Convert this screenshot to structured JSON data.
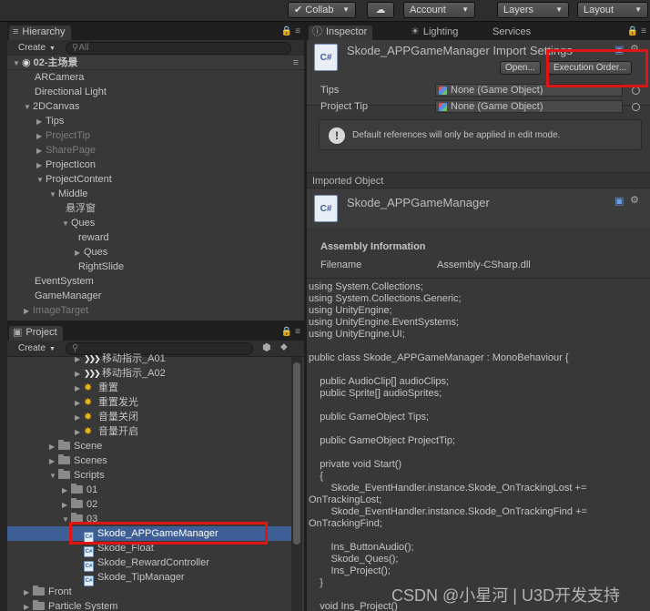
{
  "toolbar": {
    "collab": "Collab",
    "cloud_icon": "cloud-icon",
    "account": "Account",
    "layers": "Layers",
    "layout": "Layout"
  },
  "hierarchy": {
    "tab": "Hierarchy",
    "create": "Create",
    "search_placeholder": "All",
    "scene": "02-主场景",
    "items": [
      {
        "label": "ARCamera",
        "dim": false
      },
      {
        "label": "Directional Light",
        "dim": false
      },
      {
        "label": "2DCanvas",
        "dim": false
      },
      {
        "label": "Tips",
        "dim": false
      },
      {
        "label": "ProjectTip",
        "dim": true
      },
      {
        "label": "SharePage",
        "dim": true
      },
      {
        "label": "ProjectIcon",
        "dim": false
      },
      {
        "label": "ProjectContent",
        "dim": false
      },
      {
        "label": "Middle",
        "dim": false
      },
      {
        "label": "悬浮窗",
        "dim": false
      },
      {
        "label": "Ques",
        "dim": false
      },
      {
        "label": "reward",
        "dim": false
      },
      {
        "label": "Ques",
        "dim": false
      },
      {
        "label": "RightSlide",
        "dim": false
      },
      {
        "label": "EventSystem",
        "dim": false
      },
      {
        "label": "GameManager",
        "dim": false
      },
      {
        "label": "ImageTarget",
        "dim": true
      }
    ]
  },
  "project": {
    "tab": "Project",
    "create": "Create",
    "items": [
      {
        "label": "移动指示_A01",
        "icon": "chevrons-icon"
      },
      {
        "label": "移动指示_A02",
        "icon": "chevrons-icon"
      },
      {
        "label": "重置",
        "icon": "star-icon"
      },
      {
        "label": "重置发光",
        "icon": "star-icon"
      },
      {
        "label": "音量关闭",
        "icon": "star-icon"
      },
      {
        "label": "音量开启",
        "icon": "star-icon"
      },
      {
        "label": "Scene",
        "icon": "folder-icon"
      },
      {
        "label": "Scenes",
        "icon": "folder-icon"
      },
      {
        "label": "Scripts",
        "icon": "folder-icon"
      },
      {
        "label": "01",
        "icon": "folder-icon"
      },
      {
        "label": "02",
        "icon": "folder-icon"
      },
      {
        "label": "03",
        "icon": "folder-icon"
      },
      {
        "label": "Skode_APPGameManager",
        "icon": "csharp-script-icon"
      },
      {
        "label": "Skode_Float",
        "icon": "csharp-script-icon"
      },
      {
        "label": "Skode_RewardController",
        "icon": "csharp-script-icon"
      },
      {
        "label": "Skode_TipManager",
        "icon": "csharp-script-icon"
      },
      {
        "label": "Front",
        "icon": "folder-icon"
      },
      {
        "label": "Particle System",
        "icon": "folder-icon"
      }
    ]
  },
  "inspector": {
    "tabs": [
      "Inspector",
      "Lighting",
      "Services"
    ],
    "title": "Skode_APPGameManager Import Settings",
    "icon_text": "C#",
    "open": "Open...",
    "execution_order": "Execution Order...",
    "fields": [
      {
        "label": "Tips",
        "value": "None (Game Object)"
      },
      {
        "label": "Project Tip",
        "value": "None (Game Object)"
      }
    ],
    "help": "Default references will only be applied in edit mode.",
    "imported_object": "Imported Object",
    "object_title": "Skode_APPGameManager",
    "assembly_title": "Assembly Information",
    "filename_label": "Filename",
    "filename_value": "Assembly-CSharp.dll",
    "code": [
      "using System.Collections;",
      "using System.Collections.Generic;",
      "using UnityEngine;",
      "using UnityEngine.EventSystems;",
      "using UnityEngine.UI;",
      "",
      "public class Skode_APPGameManager : MonoBehaviour {",
      "",
      "    public AudioClip[] audioClips;",
      "    public Sprite[] audioSprites;",
      "",
      "    public GameObject Tips;",
      "",
      "    public GameObject ProjectTip;",
      "",
      "    private void Start()",
      "    {",
      "        Skode_EventHandler.instance.Skode_OnTrackingLost +=",
      "OnTrackingLost;",
      "        Skode_EventHandler.instance.Skode_OnTrackingFind +=",
      "OnTrackingFind;",
      "",
      "        Ins_ButtonAudio();",
      "        Skode_Ques();",
      "        Ins_Project();",
      "    }",
      "",
      "    void Ins_Project()"
    ]
  },
  "watermark": "CSDN @小星河 | U3D开发支持"
}
